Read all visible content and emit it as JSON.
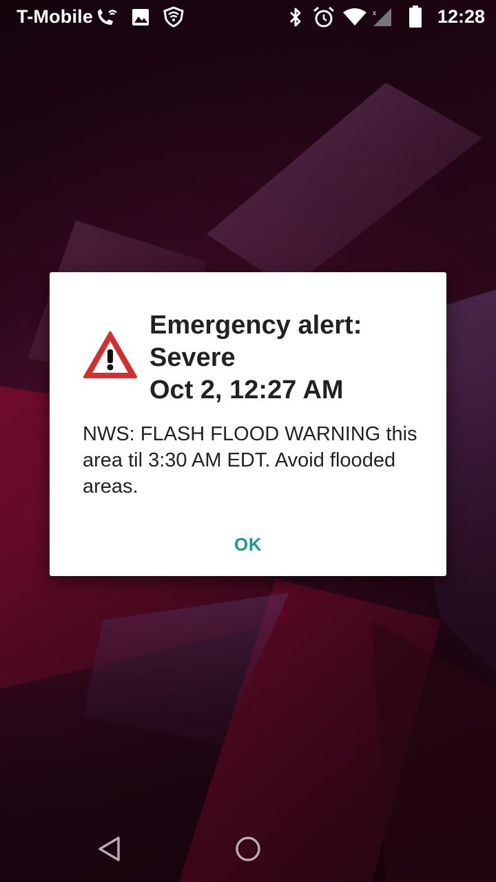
{
  "status_bar": {
    "carrier": "T-Mobile",
    "time": "12:28",
    "left_icons": [
      "wifi-calling-icon",
      "image-icon",
      "vpn-shield-icon"
    ],
    "right_icons": [
      "bluetooth-icon",
      "alarm-icon",
      "wifi-icon",
      "signal-icon",
      "battery-icon"
    ]
  },
  "dialog": {
    "title_line1": "Emergency alert:",
    "title_line2": "Severe",
    "title_line3": "Oct 2, 12:27 AM",
    "icon": "warning-triangle-icon",
    "message": "NWS: FLASH FLOOD WARNING this area til 3:30 AM EDT. Avoid flooded areas.",
    "ok_label": "OK",
    "accent_color": "#1a9a8a"
  },
  "nav_bar": {
    "icons": [
      "back-icon",
      "home-icon"
    ]
  }
}
